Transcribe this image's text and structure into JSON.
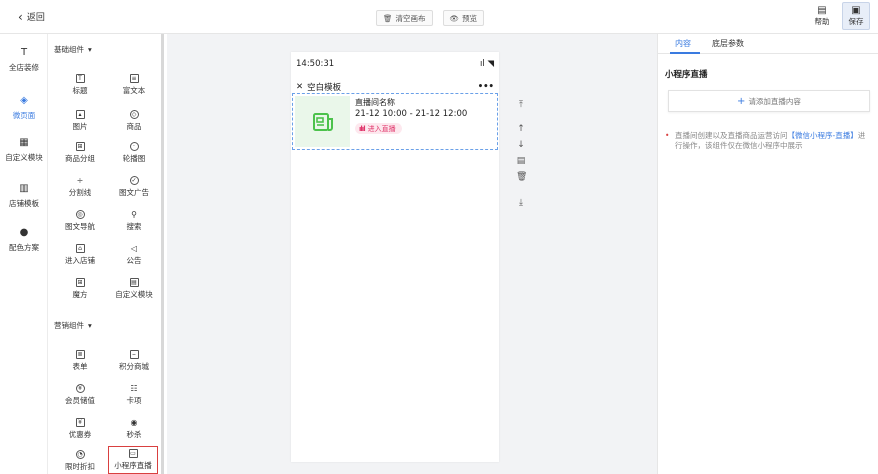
{
  "topbar": {
    "back_label": "返回",
    "clear_label": "清空画布",
    "preview_label": "预览",
    "help_label": "帮助",
    "save_label": "保存"
  },
  "leftnav": {
    "items": [
      {
        "label": "全店装修",
        "icon": "brush-icon"
      },
      {
        "label": "微页面",
        "icon": "layers-icon",
        "active": true
      },
      {
        "label": "自定义模块",
        "icon": "module-icon"
      },
      {
        "label": "店铺模板",
        "icon": "template-icon"
      },
      {
        "label": "配色方案",
        "icon": "palette-icon"
      }
    ]
  },
  "components": {
    "basic_title": "基础组件",
    "basic": [
      {
        "label": "标题"
      },
      {
        "label": "富文本"
      },
      {
        "label": "图片"
      },
      {
        "label": "商品"
      },
      {
        "label": "商品分组"
      },
      {
        "label": "轮播图"
      },
      {
        "label": "分割线"
      },
      {
        "label": "图文广告"
      },
      {
        "label": "图文导航"
      },
      {
        "label": "搜索"
      },
      {
        "label": "进入店铺"
      },
      {
        "label": "公告"
      },
      {
        "label": "魔方"
      },
      {
        "label": "自定义模块"
      }
    ],
    "marketing_title": "营销组件",
    "marketing": [
      {
        "label": "表单"
      },
      {
        "label": "积分商城"
      },
      {
        "label": "会员储值"
      },
      {
        "label": "卡项"
      },
      {
        "label": "优惠券"
      },
      {
        "label": "秒杀"
      },
      {
        "label": "限时折扣"
      },
      {
        "label": "小程序直播"
      }
    ]
  },
  "phone": {
    "time": "14:50:31",
    "page_title": "空白模板",
    "live": {
      "name": "直播间名称",
      "time_range": "21-12 10:00 - 21-12 12:00",
      "enter_label": "进入直播"
    }
  },
  "rightpanel": {
    "tabs": [
      "内容",
      "底层参数"
    ],
    "title": "小程序直播",
    "add_label": "请添加直播内容",
    "note_pre": "直播间创建以及直播商品运营访问",
    "note_link": "【微信小程序-直播】",
    "note_post": "进行操作，该组件仅在微信小程序中展示"
  },
  "colors": {
    "accent": "#3a7be0",
    "live_pink": "#e0356b",
    "selected_border": "#d94040"
  }
}
